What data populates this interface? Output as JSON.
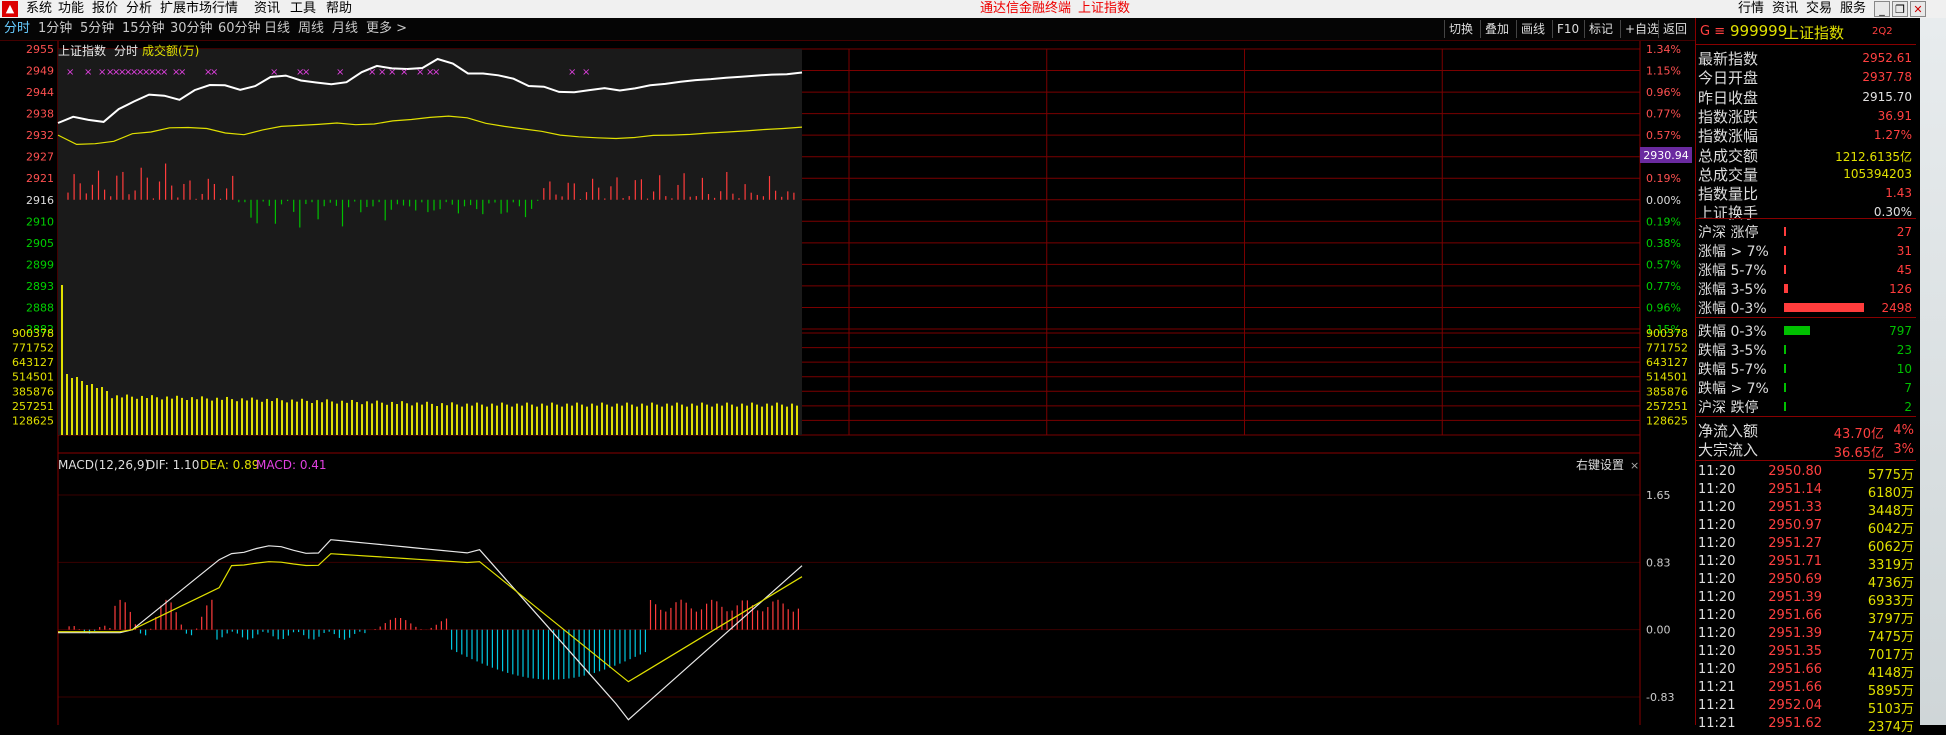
{
  "menubar": {
    "items": [
      "系统",
      "功能",
      "报价",
      "分析",
      "扩展市场行情",
      "资讯",
      "工具",
      "帮助"
    ],
    "title": "通达信金融终端",
    "stock": "上证指数",
    "right": [
      "行情",
      "资讯",
      "交易",
      "服务"
    ]
  },
  "toolbar": {
    "timeframes": [
      "分时",
      "1分钟",
      "5分钟",
      "15分钟",
      "30分钟",
      "60分钟",
      "日线",
      "周线",
      "月线",
      "更多 >"
    ],
    "right": [
      "切换",
      "叠加",
      "画线",
      "F10",
      "标记",
      "+自选",
      "返回"
    ]
  },
  "chart": {
    "index_label": "上证指数",
    "mode": "分时",
    "vol_label": "成交额(万)",
    "price_ticks": [
      "2955",
      "2949",
      "2944",
      "2938",
      "2932",
      "2927",
      "2921",
      "2916",
      "2910",
      "2905",
      "2899",
      "2893",
      "2888",
      "2882"
    ],
    "pct_ticks": [
      "1.34%",
      "1.15%",
      "0.96%",
      "0.77%",
      "0.57%",
      "0.38%",
      "0.19%",
      "0.00%",
      "0.19%",
      "0.38%",
      "0.57%",
      "0.77%",
      "0.96%",
      "1.15%"
    ],
    "price_box": "2930.94",
    "vol_ticks": [
      "900378",
      "771752",
      "643127",
      "514501",
      "385876",
      "257251",
      "128625"
    ],
    "macd_label": "MACD(12,26,9)",
    "dif": "DIF: 1.10",
    "dea": "DEA: 0.89",
    "macd": "MACD: 0.41",
    "macd_ticks": [
      "1.65",
      "0.83",
      "0.00",
      "-0.83"
    ],
    "right_settings": "右键设置"
  },
  "chart_data": {
    "type": "line",
    "title": "上证指数 分时",
    "series": [
      {
        "name": "上证指数",
        "values": [
          2936.6,
          2938.4,
          2937.5,
          2936.9,
          2940.6,
          2942.8,
          2944.8,
          2944.5,
          2943.3,
          2946.1,
          2947.6,
          2947.5,
          2946.2,
          2947.3,
          2949.9,
          2950.3,
          2948.9,
          2948.3,
          2947.8,
          2948.4,
          2951.3,
          2953.1,
          2952.4,
          2952.2,
          2952.5,
          2955.1,
          2953.8,
          2950.9,
          2950.9,
          2950.4,
          2949.4,
          2947.3,
          2947.1,
          2945.6,
          2945.5,
          2946.1,
          2946.7,
          2946.0,
          2946.6,
          2947.5,
          2947.9,
          2948.5,
          2949.0,
          2949.3,
          2949.7,
          2950.0,
          2950.3,
          2950.6,
          2950.7,
          2951.2
        ]
      },
      {
        "name": "均线",
        "values": [
          2933.1,
          2930.4,
          2930.6,
          2931.3,
          2933.5,
          2934.0,
          2935.2,
          2935.3,
          2935.0,
          2933.7,
          2933.2,
          2934.6,
          2935.6,
          2935.9,
          2936.2,
          2936.6,
          2936.1,
          2936.3,
          2937.2,
          2937.6,
          2938.2,
          2938.6,
          2938.1,
          2936.5,
          2935.6,
          2934.9,
          2934.2,
          2933.1,
          2932.6,
          2932.3,
          2932.1,
          2932.4,
          2933.0,
          2933.1,
          2933.3,
          2933.7,
          2934.0,
          2934.3,
          2934.7,
          2935.0,
          2935.4
        ]
      }
    ],
    "ylim": [
      2877,
      2958
    ]
  },
  "right_panel": {
    "code": "999999",
    "name": "上证指数",
    "flag": "2Q2",
    "stats": [
      {
        "label": "最新指数",
        "value": "2952.61",
        "color": "#ff4040"
      },
      {
        "label": "今日开盘",
        "value": "2937.78",
        "color": "#ff4040"
      },
      {
        "label": "昨日收盘",
        "value": "2915.70",
        "color": "#e0e0e0"
      },
      {
        "label": "指数涨跌",
        "value": "36.91",
        "color": "#ff4040"
      },
      {
        "label": "指数涨幅",
        "value": "1.27%",
        "color": "#ff4040"
      },
      {
        "label": "总成交额",
        "value": "1212.6135亿",
        "color": "#e0e000"
      },
      {
        "label": "总成交量",
        "value": "105394203",
        "color": "#e0e000"
      },
      {
        "label": "指数量比",
        "value": "1.43",
        "color": "#ff4040"
      },
      {
        "label": "上证换手",
        "value": "0.30%",
        "color": "#e0e0e0"
      }
    ],
    "breadth_up": [
      {
        "label": "沪深 涨停",
        "value": "27",
        "frac": 0.011
      },
      {
        "label": "涨幅 > 7%",
        "value": "31",
        "frac": 0.012
      },
      {
        "label": "涨幅 5-7%",
        "value": "45",
        "frac": 0.018
      },
      {
        "label": "涨幅 3-5%",
        "value": "126",
        "frac": 0.05
      },
      {
        "label": "涨幅 0-3%",
        "value": "2498",
        "frac": 1.0
      }
    ],
    "breadth_down": [
      {
        "label": "跌幅 0-3%",
        "value": "797",
        "frac": 0.32
      },
      {
        "label": "跌幅 3-5%",
        "value": "23",
        "frac": 0.01
      },
      {
        "label": "跌幅 5-7%",
        "value": "10",
        "frac": 0.005
      },
      {
        "label": "跌幅 > 7%",
        "value": "7",
        "frac": 0.004
      },
      {
        "label": "沪深 跌停",
        "value": "2",
        "frac": 0.002
      }
    ],
    "flows": [
      {
        "label": "净流入额",
        "value": "43.70亿",
        "pct": "4%"
      },
      {
        "label": "大宗流入",
        "value": "36.65亿",
        "pct": "3%"
      }
    ],
    "ticks": [
      [
        "11:20",
        "2950.80",
        "5775万"
      ],
      [
        "11:20",
        "2951.14",
        "6180万"
      ],
      [
        "11:20",
        "2951.33",
        "3448万"
      ],
      [
        "11:20",
        "2950.97",
        "6042万"
      ],
      [
        "11:20",
        "2951.27",
        "6062万"
      ],
      [
        "11:20",
        "2951.71",
        "3319万"
      ],
      [
        "11:20",
        "2950.69",
        "4736万"
      ],
      [
        "11:20",
        "2951.39",
        "6933万"
      ],
      [
        "11:20",
        "2951.66",
        "3797万"
      ],
      [
        "11:20",
        "2951.39",
        "7475万"
      ],
      [
        "11:20",
        "2951.35",
        "7017万"
      ],
      [
        "11:20",
        "2951.66",
        "4148万"
      ],
      [
        "11:21",
        "2951.66",
        "5895万"
      ],
      [
        "11:21",
        "2952.04",
        "5103万"
      ],
      [
        "11:21",
        "2951.62",
        "2374万"
      ]
    ]
  },
  "colors": {
    "up": "#ff3c3c",
    "down": "#00c000",
    "yellow": "#e0e000",
    "grid": "#7a0000"
  }
}
